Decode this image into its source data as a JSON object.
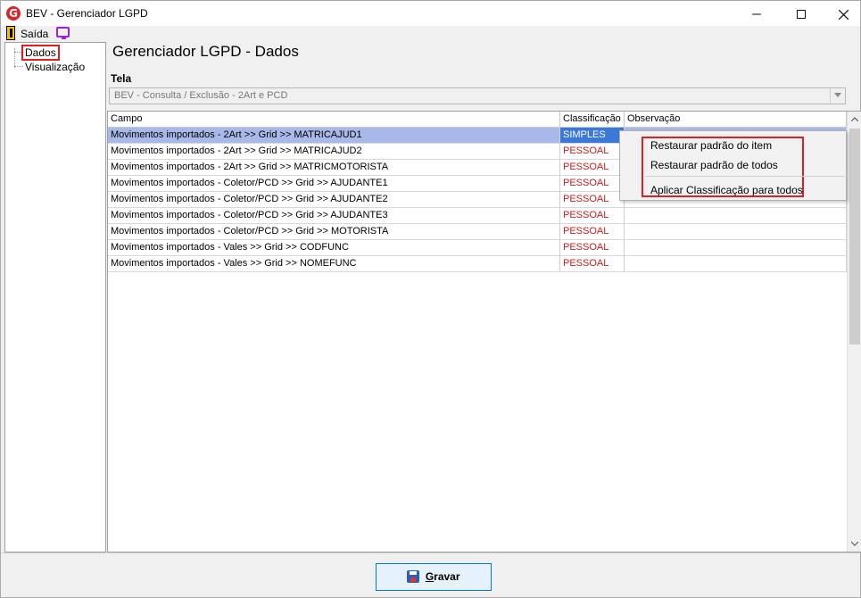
{
  "window": {
    "title": "BEV - Gerenciador LGPD",
    "app_icon_letter": "G"
  },
  "menu": {
    "exit_label": "Saída"
  },
  "tree": {
    "items": [
      {
        "label": "Dados",
        "selected": true
      },
      {
        "label": "Visualização",
        "selected": false
      }
    ]
  },
  "main": {
    "title": "Gerenciador LGPD - Dados",
    "screen_label": "Tela",
    "screen_value": "BEV - Consulta / Exclusão - 2Art e PCD"
  },
  "grid": {
    "columns": [
      "Campo",
      "Classificação",
      "Observação"
    ],
    "rows": [
      {
        "campo": "Movimentos importados - 2Art >> Grid >> MATRICAJUD1",
        "classificacao": "SIMPLES",
        "observacao": ""
      },
      {
        "campo": "Movimentos importados - 2Art >> Grid >> MATRICAJUD2",
        "classificacao": "PESSOAL",
        "observacao": ""
      },
      {
        "campo": "Movimentos importados - 2Art >> Grid >> MATRICMOTORISTA",
        "classificacao": "PESSOAL",
        "observacao": ""
      },
      {
        "campo": "Movimentos importados - Coletor/PCD >> Grid >> AJUDANTE1",
        "classificacao": "PESSOAL",
        "observacao": ""
      },
      {
        "campo": "Movimentos importados - Coletor/PCD >> Grid >> AJUDANTE2",
        "classificacao": "PESSOAL",
        "observacao": ""
      },
      {
        "campo": "Movimentos importados - Coletor/PCD >> Grid >> AJUDANTE3",
        "classificacao": "PESSOAL",
        "observacao": ""
      },
      {
        "campo": "Movimentos importados - Coletor/PCD >> Grid >> MOTORISTA",
        "classificacao": "PESSOAL",
        "observacao": ""
      },
      {
        "campo": "Movimentos importados - Vales >> Grid >> CODFUNC",
        "classificacao": "PESSOAL",
        "observacao": ""
      },
      {
        "campo": "Movimentos importados - Vales >> Grid >> NOMEFUNC",
        "classificacao": "PESSOAL",
        "observacao": ""
      }
    ]
  },
  "context_menu": {
    "items": [
      "Restaurar padrão do item",
      "Restaurar padrão de todos",
      "Aplicar Classificação para todos"
    ]
  },
  "footer": {
    "save_label_first": "G",
    "save_label_rest": "ravar"
  },
  "colors": {
    "pessoal_text": "#c81e1e",
    "selected_row": "#a8b8e8",
    "selected_cell": "#3b78d8",
    "highlight_outline": "#e02020"
  }
}
